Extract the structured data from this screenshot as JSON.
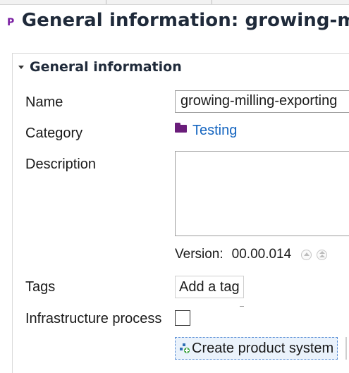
{
  "editor": {
    "title": "General information: growing-milling",
    "icon_letter": "P"
  },
  "section": {
    "title": "General information",
    "icon": "chevron-down-icon"
  },
  "fields": {
    "name_label": "Name",
    "name_value": "growing-milling-exporting",
    "category_label": "Category",
    "category_value": "Testing",
    "category_icon": "folder-icon",
    "description_label": "Description",
    "description_value": "",
    "version_label": "Version:",
    "version_value": "00.00.014",
    "tags_label": "Tags",
    "add_tag_label": "Add a tag",
    "infrastructure_label": "Infrastructure process",
    "infrastructure_checked": false
  },
  "actions": {
    "create_product_system_label": "Create product system",
    "create_product_system_icon": "product-system-add-icon"
  },
  "colors": {
    "title_text": "#1f2a3a",
    "process_icon": "#7a1fa2",
    "folder": "#6a1d7a",
    "link": "#1565c0",
    "focus_button_bg": "#eaf2fb",
    "focus_border": "#5a8fd6"
  }
}
